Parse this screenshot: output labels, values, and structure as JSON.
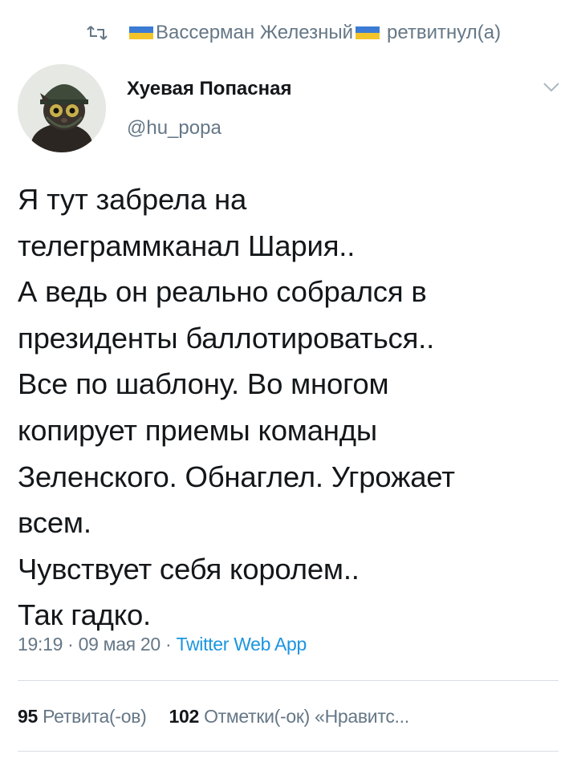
{
  "retweet": {
    "user": "Вассерман Железный",
    "suffix": "ретвитнул(а)"
  },
  "author": {
    "name": "Хуевая Попасная",
    "handle": "@hu_popa"
  },
  "tweet": {
    "text": "Я тут забрела на\nтелеграммканал Шария..\nА ведь он реально собрался в\nпрезиденты баллотироваться..\nВсе по шаблону. Во многом\nкопирует приемы команды\nЗеленского. Обнаглел. Угрожает\nвсем.\nЧувствует себя королем..\nТак гадко.",
    "time": "19:19",
    "date": "09 мая 20",
    "separator": "·",
    "source": "Twitter Web App"
  },
  "stats": {
    "retweets_count": "95",
    "retweets_label": "Ретвита(-ов)",
    "likes_count": "102",
    "likes_label": "Отметки(-ок) «Нравитс..."
  },
  "colors": {
    "text": "#14171a",
    "secondary": "#657786",
    "link": "#1b95e0",
    "divider": "#d8dde2"
  }
}
